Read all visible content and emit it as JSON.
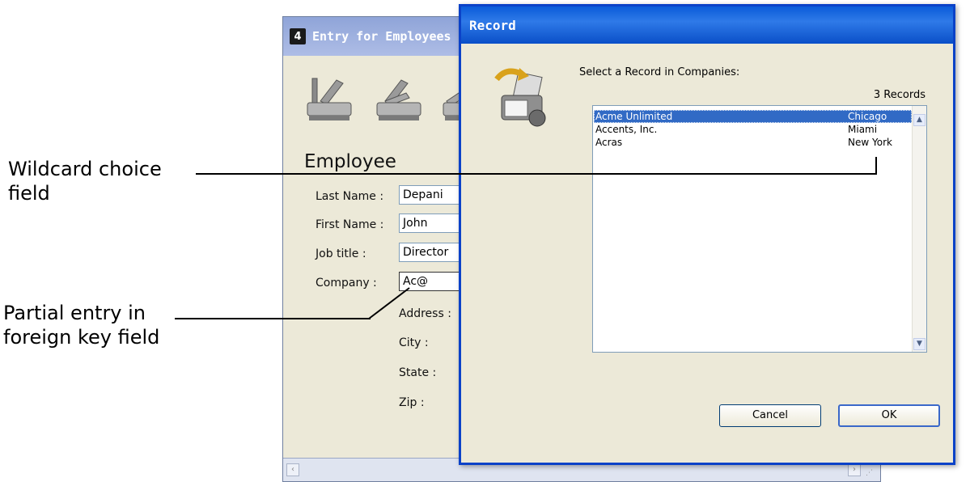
{
  "callouts": {
    "wildcard": {
      "line1": "Wildcard choice",
      "line2": "field"
    },
    "partial": {
      "line1": "Partial entry in",
      "line2": "foreign key field"
    }
  },
  "back_window": {
    "title": "Entry for Employees",
    "form_title": "Employee",
    "fields": [
      {
        "label": "Last Name :",
        "value": "Depani"
      },
      {
        "label": "First Name :",
        "value": "John"
      },
      {
        "label": "Job title :",
        "value": "Director"
      },
      {
        "label": "Company :",
        "value": "Ac@"
      }
    ],
    "related_labels": [
      "Address :",
      "City :",
      "State :",
      "Zip :"
    ]
  },
  "dialog": {
    "title": "Record",
    "prompt": "Select a Record in Companies:",
    "count": "3 Records",
    "records": [
      {
        "name": "Acme Unlimited",
        "city": "Chicago",
        "selected": true
      },
      {
        "name": "Accents, Inc.",
        "city": "Miami",
        "selected": false
      },
      {
        "name": "Acras",
        "city": "New York",
        "selected": false
      }
    ],
    "cancel_label": "Cancel",
    "ok_label": "OK"
  },
  "icons": {
    "app": "4d-logo-icon",
    "toolbar": [
      "first-record-icon",
      "previous-record-icon",
      "next-record-icon"
    ],
    "dialog": "record-select-icon"
  },
  "colors": {
    "dialog_title_bar": "#0a5bd9",
    "back_title_bar": "#8fa4d8",
    "selection": "#316ac5",
    "window_bg": "#ece9d8"
  }
}
